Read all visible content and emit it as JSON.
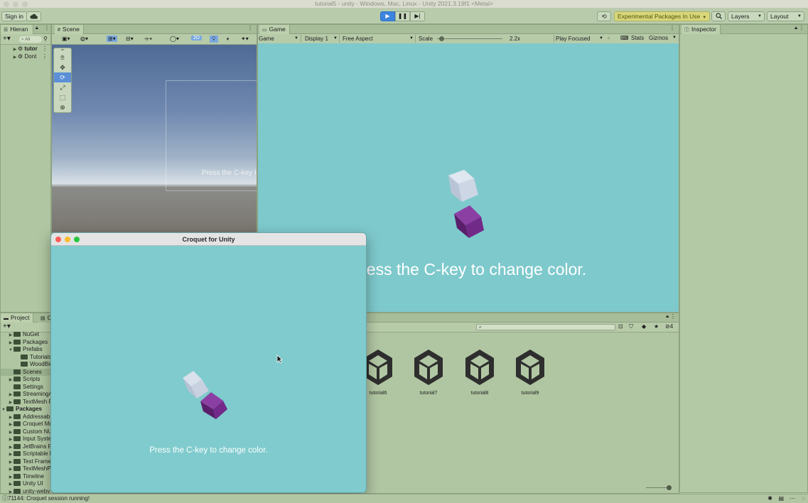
{
  "window": {
    "title": "tutorial5 - unity - Windows, Mac, Linux - Unity 2021.3.19f1 <Metal>"
  },
  "toolbar": {
    "sign_in": "Sign in",
    "experimental_packages": "Experimental Packages In Use",
    "layers": "Layers",
    "layout": "Layout"
  },
  "hierarchy": {
    "tab": "Hieran",
    "search_placeholder": "All",
    "items": [
      "tutor",
      "Dont"
    ]
  },
  "scene": {
    "tab": "Scene",
    "mode_2d": "2D",
    "overlay_text": "Press the C-key t"
  },
  "game": {
    "tab": "Game",
    "view_select": "Game",
    "display": "Display 1",
    "aspect": "Free Aspect",
    "scale_label": "Scale",
    "scale_value": "2.2x",
    "play_mode": "Play Focused",
    "stats": "Stats",
    "gizmos": "Gizmos",
    "message": "Press the C-key to change color."
  },
  "inspector": {
    "tab": "Inspector"
  },
  "project": {
    "tab": "Project",
    "tab2": "C",
    "hidden_count": "4",
    "tree": [
      {
        "label": "NuGet",
        "depth": 1,
        "arrow": "right"
      },
      {
        "label": "Packages",
        "depth": 1,
        "arrow": "right"
      },
      {
        "label": "Prefabs",
        "depth": 1,
        "arrow": "down"
      },
      {
        "label": "Tutorials",
        "depth": 2,
        "arrow": ""
      },
      {
        "label": "WoodBlo",
        "depth": 2,
        "arrow": ""
      },
      {
        "label": "Scenes",
        "depth": 1,
        "arrow": "",
        "selected": true
      },
      {
        "label": "Scripts",
        "depth": 1,
        "arrow": "right"
      },
      {
        "label": "Settings",
        "depth": 1,
        "arrow": ""
      },
      {
        "label": "StreamingA",
        "depth": 1,
        "arrow": "right"
      },
      {
        "label": "TextMesh F",
        "depth": 1,
        "arrow": "right"
      },
      {
        "label": "Packages",
        "depth": 0,
        "arrow": "down",
        "bold": true
      },
      {
        "label": "Addressab",
        "depth": 1,
        "arrow": "right"
      },
      {
        "label": "Croquet Mu",
        "depth": 1,
        "arrow": "right"
      },
      {
        "label": "Custom NU",
        "depth": 1,
        "arrow": "right"
      },
      {
        "label": "Input Syste",
        "depth": 1,
        "arrow": "right"
      },
      {
        "label": "JetBrains R",
        "depth": 1,
        "arrow": "right"
      },
      {
        "label": "Scriptable E",
        "depth": 1,
        "arrow": "right"
      },
      {
        "label": "Test Frame",
        "depth": 1,
        "arrow": "right"
      },
      {
        "label": "TextMeshP",
        "depth": 1,
        "arrow": "right"
      },
      {
        "label": "Timeline",
        "depth": 1,
        "arrow": "right"
      },
      {
        "label": "Unity UI",
        "depth": 1,
        "arrow": "right"
      },
      {
        "label": "unity-webv",
        "depth": 1,
        "arrow": "right"
      }
    ],
    "assets": [
      "tutorial6",
      "tutorial7",
      "tutorial8",
      "tutorial9"
    ]
  },
  "croquet_window": {
    "title": "Croquet for Unity",
    "message": "Press the C-key to change color."
  },
  "status": {
    "message": "71144: Croquet session running!"
  },
  "colors": {
    "editor_bg": "#b1c7a3",
    "game_bg": "#7ec9cc",
    "cube_light": "#c9d3e0",
    "cube_purple": "#7a2f8e",
    "play_active": "#3d84e0"
  }
}
